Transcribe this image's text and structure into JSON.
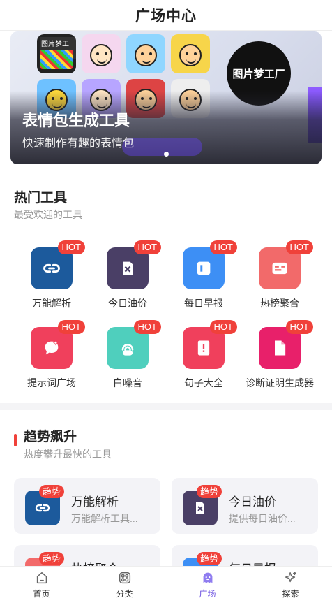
{
  "header": {
    "title": "广场中心"
  },
  "banner": {
    "title": "表情包生成工具",
    "subtitle": "快速制作有趣的表情包",
    "sticker_caption": "图片梦工厂",
    "logo_text": "图片梦工厂"
  },
  "hot_tools": {
    "title": "热门工具",
    "subtitle": "最受欢迎的工具",
    "badge": "HOT",
    "items": [
      {
        "label": "万能解析",
        "color": "#1c5a9c",
        "icon": "link-icon"
      },
      {
        "label": "今日油价",
        "color": "#4a3f66",
        "icon": "fuel-icon"
      },
      {
        "label": "每日早报",
        "color": "#3d8ff5",
        "icon": "newspaper-icon"
      },
      {
        "label": "热榜聚合",
        "color": "#f26a6a",
        "icon": "list-card-icon"
      },
      {
        "label": "提示词广场",
        "color": "#f0405c",
        "icon": "chat-sparkle-icon"
      },
      {
        "label": "白噪音",
        "color": "#4fcfbd",
        "icon": "broadcast-icon"
      },
      {
        "label": "句子大全",
        "color": "#f0405c",
        "icon": "book-alert-icon"
      },
      {
        "label": "诊断证明生成器",
        "color": "#e8206a",
        "icon": "document-icon"
      }
    ]
  },
  "trending": {
    "title": "趋势飙升",
    "subtitle": "热度攀升最快的工具",
    "badge": "趋势",
    "items": [
      {
        "title": "万能解析",
        "desc": "万能解析工具...",
        "color": "#1c5a9c",
        "icon": "link-icon"
      },
      {
        "title": "今日油价",
        "desc": "提供每日油价...",
        "color": "#4a3f66",
        "icon": "fuel-icon"
      },
      {
        "title": "热榜聚合",
        "desc": "",
        "color": "#f26a6a",
        "icon": "list-card-icon"
      },
      {
        "title": "每日早报",
        "desc": "",
        "color": "#3d8ff5",
        "icon": "newspaper-icon"
      }
    ]
  },
  "tabbar": {
    "items": [
      {
        "label": "首页",
        "icon": "home-icon"
      },
      {
        "label": "分类",
        "icon": "grid-icon"
      },
      {
        "label": "广场",
        "icon": "ghost-icon",
        "active": true
      },
      {
        "label": "探索",
        "icon": "sparkle-icon"
      }
    ]
  },
  "colors": {
    "accent": "#6a4fe0",
    "hot": "#f0413a"
  }
}
